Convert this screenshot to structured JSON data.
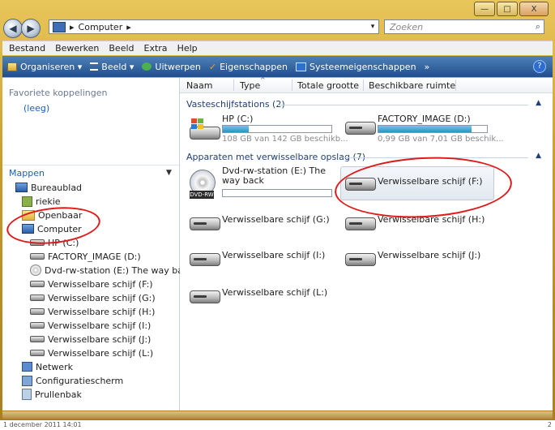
{
  "window": {
    "controls": [
      "—",
      "□",
      "X"
    ]
  },
  "address": {
    "breadcrumb": "Computer",
    "search_placeholder": "Zoeken"
  },
  "menu": [
    "Bestand",
    "Bewerken",
    "Beeld",
    "Extra",
    "Help"
  ],
  "commands": [
    {
      "label": "Organiseren ▾",
      "icon": "organize-icon"
    },
    {
      "label": "Beeld ▾",
      "icon": "view-icon"
    },
    {
      "label": "Uitwerpen",
      "icon": "eject-icon"
    },
    {
      "label": "Eigenschappen",
      "icon": "checkmark-icon"
    },
    {
      "label": "Systeemeigenschappen",
      "icon": "system-properties-icon"
    },
    {
      "label": "»",
      "icon": "more-icon"
    }
  ],
  "help_label": "?",
  "nav": {
    "favorites_title": "Favoriete koppelingen",
    "favorites_empty": "(leeg)",
    "folders_title": "Mappen",
    "tree": [
      "Bureaublad",
      "riekie",
      "Openbaar",
      "Computer",
      "HP (C:)",
      "FACTORY_IMAGE (D:)",
      "Dvd-rw-station (E:) The way back",
      "Verwisselbare schijf (F:)",
      "Verwisselbare schijf (G:)",
      "Verwisselbare schijf (H:)",
      "Verwisselbare schijf (I:)",
      "Verwisselbare schijf (J:)",
      "Verwisselbare schijf (L:)",
      "Netwerk",
      "Configuratiescherm",
      "Prullenbak"
    ]
  },
  "columns": [
    "Naam",
    "Type",
    "Totale grootte",
    "Beschikbare ruimte"
  ],
  "groups": {
    "fixed": "Vasteschijfstations (2)",
    "removable": "Apparaten met verwisselbare opslag (7)"
  },
  "drives": {
    "c": {
      "name": "HP (C:)",
      "free": "108 GB van 142 GB beschikb...",
      "used_fraction": 0.24
    },
    "d": {
      "name": "FACTORY_IMAGE (D:)",
      "free": "0,99 GB van 7,01 GB beschik...",
      "used_fraction": 0.86
    },
    "e": {
      "name": "Dvd-rw-station (E:) The way back",
      "icon_text": "DVD-RW"
    },
    "f": "Verwisselbare schijf (F:)",
    "g": "Verwisselbare schijf (G:)",
    "h": "Verwisselbare schijf (H:)",
    "i": "Verwisselbare schijf (I:)",
    "j": "Verwisselbare schijf (J:)",
    "l": "Verwisselbare schijf (L:)"
  },
  "footer": {
    "left": "1 december 2011 14:01",
    "right": "2"
  }
}
